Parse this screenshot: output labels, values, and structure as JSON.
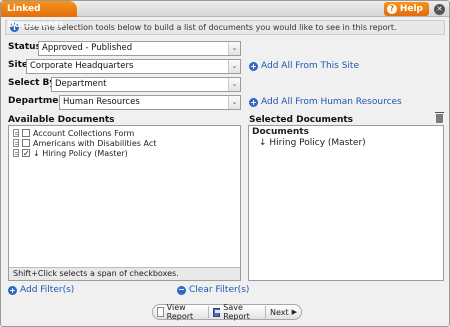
{
  "window": {
    "title": "Linked Documents",
    "help_label": "Help"
  },
  "info": {
    "text": "Use the selection tools below to build a list of documents you would like to see in this report."
  },
  "form": {
    "status": {
      "label": "Status",
      "value": "Approved - Published"
    },
    "site": {
      "label": "Site",
      "value": "Corporate Headquarters"
    },
    "select_by": {
      "label": "Select By",
      "value": "Department"
    },
    "department": {
      "label": "Department",
      "value": "Human Resources"
    },
    "add_all_site": "Add All From This Site",
    "add_all_department": "Add All From Human Resources"
  },
  "available": {
    "title": "Available Documents",
    "items": [
      {
        "label": "Account Collections Form",
        "checked": false
      },
      {
        "label": "Americans with Disabilities Act",
        "checked": false
      },
      {
        "label": "↓ Hiring Policy (Master)",
        "checked": true
      }
    ],
    "hint": "Shift+Click selects a span of checkboxes."
  },
  "selected": {
    "title": "Selected Documents",
    "group_label": "Documents",
    "items": [
      "↓ Hiring Policy (Master)"
    ]
  },
  "filters": {
    "add_label": "Add Filter(s)",
    "clear_label": "Clear Filter(s)"
  },
  "toolbar": {
    "view_label": "View Report",
    "save_label": "Save Report",
    "next_label": "Next"
  }
}
